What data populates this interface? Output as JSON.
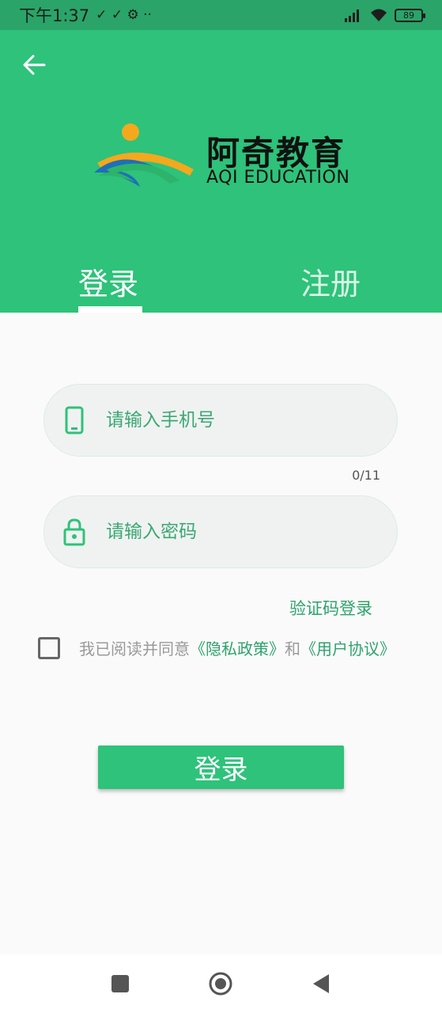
{
  "status_bar": {
    "time": "下午1:37",
    "left_icons": "✓ ✓ ⚙ ··",
    "battery": "89"
  },
  "header": {
    "brand_cn": "阿奇教育",
    "brand_en": "AQI EDUCATION"
  },
  "tabs": {
    "login": "登录",
    "register": "注册"
  },
  "form": {
    "phone_placeholder": "请输入手机号",
    "phone_counter": "0/11",
    "password_placeholder": "请输入密码",
    "sms_login": "验证码登录",
    "agree_prefix": "我已阅读并同意",
    "privacy_policy": "《隐私政策》",
    "agree_and": "和",
    "user_agreement": "《用户协议》",
    "login_button": "登录"
  },
  "colors": {
    "primary": "#2ec27a",
    "status_bar": "#2aa468",
    "link": "#2ea36c"
  }
}
